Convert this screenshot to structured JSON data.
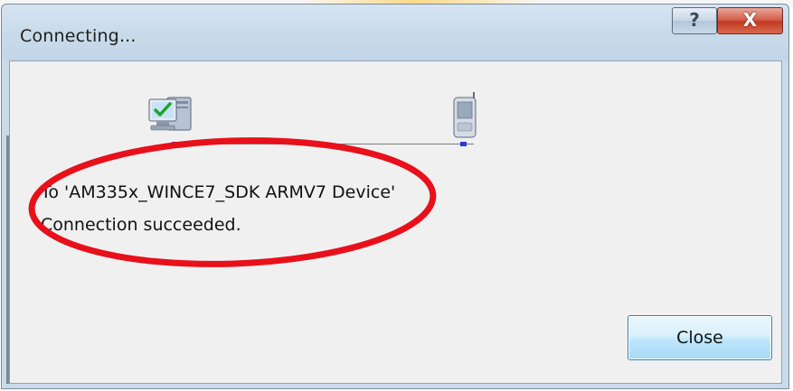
{
  "window": {
    "title": "Connecting...",
    "help_glyph": "?",
    "close_glyph": "X"
  },
  "message": {
    "target": "To 'AM335x_WINCE7_SDK ARMV7 Device'",
    "status": "Connection succeeded."
  },
  "buttons": {
    "close_label": "Close"
  },
  "icons": {
    "pc": "desktop-computer-check-icon",
    "device": "mobile-device-icon"
  },
  "colors": {
    "annotation": "#e8101a",
    "accent": "#3c7fb1"
  }
}
